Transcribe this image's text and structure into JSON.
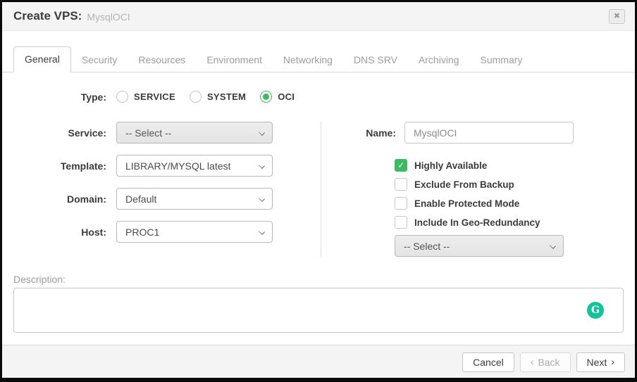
{
  "dialog": {
    "title": "Create VPS:",
    "title_value": "MysqlOCI",
    "close_glyph": "✖"
  },
  "tabs": [
    {
      "label": "General",
      "active": true
    },
    {
      "label": "Security",
      "active": false
    },
    {
      "label": "Resources",
      "active": false
    },
    {
      "label": "Environment",
      "active": false
    },
    {
      "label": "Networking",
      "active": false
    },
    {
      "label": "DNS SRV",
      "active": false
    },
    {
      "label": "Archiving",
      "active": false
    },
    {
      "label": "Summary",
      "active": false
    }
  ],
  "form": {
    "type": {
      "label": "Type:",
      "options": [
        {
          "label": "SERVICE",
          "checked": false
        },
        {
          "label": "SYSTEM",
          "checked": false
        },
        {
          "label": "OCI",
          "checked": true
        }
      ]
    },
    "service": {
      "label": "Service:",
      "value": "-- Select --",
      "disabled": true
    },
    "template": {
      "label": "Template:",
      "value": "LIBRARY/MYSQL latest",
      "disabled": false
    },
    "domain": {
      "label": "Domain:",
      "value": "Default",
      "disabled": false
    },
    "host": {
      "label": "Host:",
      "value": "PROC1",
      "disabled": false
    },
    "name": {
      "label": "Name:",
      "value": "MysqlOCI"
    },
    "checkboxes": [
      {
        "label": "Highly Available",
        "checked": true
      },
      {
        "label": "Exclude From Backup",
        "checked": false
      },
      {
        "label": "Enable Protected Mode",
        "checked": false
      },
      {
        "label": "Include In Geo-Redundancy",
        "checked": false
      }
    ],
    "geo_select": {
      "value": "-- Select --",
      "disabled": true
    },
    "description": {
      "label": "Description:",
      "value": ""
    }
  },
  "footer": {
    "cancel_label": "Cancel",
    "back_label": "Back",
    "back_arrow": "‹",
    "next_label": "Next",
    "next_arrow": "›"
  },
  "icons": {
    "grammarly_glyph": "G",
    "checkmark_glyph": "✓"
  },
  "colors": {
    "accent_green": "#3eb95f",
    "grammarly_green": "#15c39a",
    "header_bg": "#f4f4f4"
  }
}
